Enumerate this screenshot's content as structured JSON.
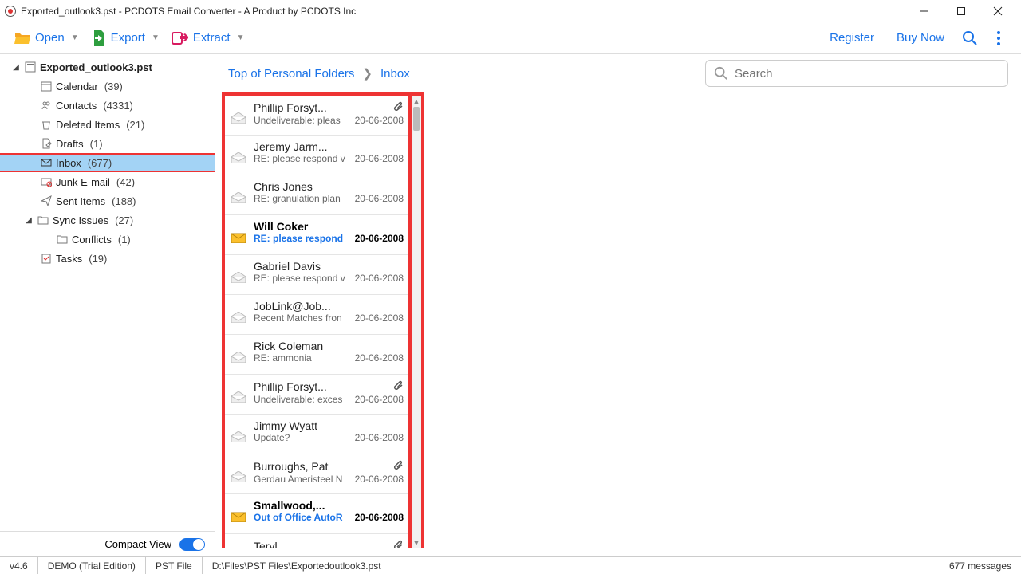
{
  "window": {
    "title": "Exported_outlook3.pst - PCDOTS Email Converter - A Product by PCDOTS Inc"
  },
  "toolbar": {
    "open": "Open",
    "export": "Export",
    "extract": "Extract",
    "register": "Register",
    "buy_now": "Buy Now"
  },
  "tree": {
    "root": {
      "label": "Exported_outlook3.pst"
    },
    "items": [
      {
        "label": "Calendar",
        "count": "(39)"
      },
      {
        "label": "Contacts",
        "count": "(4331)"
      },
      {
        "label": "Deleted Items",
        "count": "(21)"
      },
      {
        "label": "Drafts",
        "count": "(1)"
      },
      {
        "label": "Inbox",
        "count": "(677)"
      },
      {
        "label": "Junk E-mail",
        "count": "(42)"
      },
      {
        "label": "Sent Items",
        "count": "(188)"
      },
      {
        "label": "Sync Issues",
        "count": "(27)"
      },
      {
        "label": "Conflicts",
        "count": "(1)"
      },
      {
        "label": "Tasks",
        "count": "(19)"
      }
    ]
  },
  "compact_view_label": "Compact View",
  "breadcrumb": {
    "root": "Top of Personal Folders",
    "current": "Inbox"
  },
  "search": {
    "placeholder": "Search"
  },
  "emails": [
    {
      "sender": "Phillip Forsyt...",
      "subject": "Undeliverable: pleas",
      "date": "20-06-2008",
      "attach": true,
      "unread": false
    },
    {
      "sender": "Jeremy Jarm...",
      "subject": "RE: please respond v",
      "date": "20-06-2008",
      "attach": false,
      "unread": false
    },
    {
      "sender": "Chris Jones",
      "subject": "RE: granulation plan",
      "date": "20-06-2008",
      "attach": false,
      "unread": false
    },
    {
      "sender": "Will Coker",
      "subject": "RE: please respond",
      "date": "20-06-2008",
      "attach": false,
      "unread": true
    },
    {
      "sender": "Gabriel Davis",
      "subject": "RE: please respond v",
      "date": "20-06-2008",
      "attach": false,
      "unread": false
    },
    {
      "sender": "JobLink@Job...",
      "subject": "Recent Matches fron",
      "date": "20-06-2008",
      "attach": false,
      "unread": false
    },
    {
      "sender": "Rick Coleman",
      "subject": "RE: ammonia",
      "date": "20-06-2008",
      "attach": false,
      "unread": false
    },
    {
      "sender": "Phillip Forsyt...",
      "subject": "Undeliverable: exces",
      "date": "20-06-2008",
      "attach": true,
      "unread": false
    },
    {
      "sender": "Jimmy Wyatt",
      "subject": "Update?",
      "date": "20-06-2008",
      "attach": false,
      "unread": false
    },
    {
      "sender": "Burroughs, Pat",
      "subject": "Gerdau Ameristeel N",
      "date": "20-06-2008",
      "attach": true,
      "unread": false
    },
    {
      "sender": "Smallwood,...",
      "subject": "Out of Office AutoR",
      "date": "20-06-2008",
      "attach": false,
      "unread": true
    },
    {
      "sender": "Teryl",
      "subject": "",
      "date": "",
      "attach": true,
      "unread": false
    }
  ],
  "status": {
    "version": "v4.6",
    "edition": "DEMO (Trial Edition)",
    "filetype": "PST File",
    "path": "D:\\Files\\PST Files\\Exportedoutlook3.pst",
    "count": "677 messages"
  }
}
